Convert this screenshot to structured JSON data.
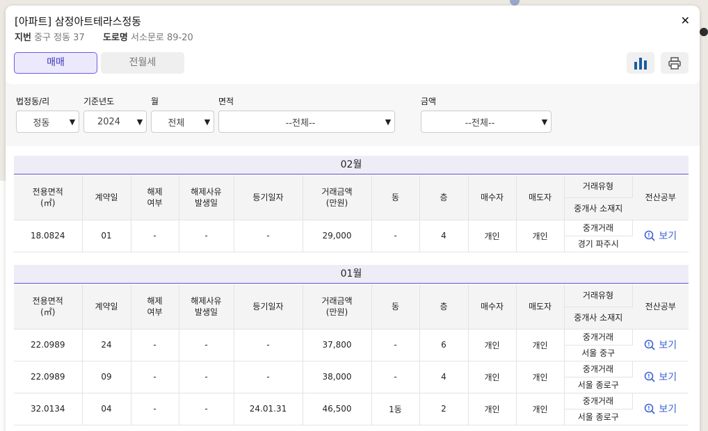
{
  "header": {
    "title": "[아파트] 삼정아트테라스정동",
    "jibun_label": "지번",
    "jibun_value": "중구 정동 37",
    "road_label": "도로명",
    "road_value": "서소문로 89-20",
    "close_icon": "close-icon"
  },
  "tabs": [
    {
      "label": "매매",
      "active": true
    },
    {
      "label": "전월세",
      "active": false
    }
  ],
  "actions": {
    "chart_icon": "bar-chart-icon",
    "print_icon": "printer-icon"
  },
  "filters": {
    "dong": {
      "label": "법정동/리",
      "value": "정동"
    },
    "year": {
      "label": "기준년도",
      "value": "2024"
    },
    "month": {
      "label": "월",
      "value": "전체"
    },
    "area": {
      "label": "면적",
      "value": "--전체--"
    },
    "price": {
      "label": "금액",
      "value": "--전체--"
    }
  },
  "columns": {
    "area": "전용면적\n(㎡)",
    "contract_day": "계약일",
    "cancel": "해제\n여부",
    "cancel_date": "해제사유\n발생일",
    "reg_date": "등기일자",
    "price": "거래금액\n(만원)",
    "building": "동",
    "floor": "층",
    "buyer": "매수자",
    "seller": "매도자",
    "deal_type": "거래유형",
    "agent_loc": "중개사 소재지",
    "ledger": "전산공부"
  },
  "months": [
    {
      "label": "02월",
      "rows": [
        {
          "area": "18.0824",
          "day": "01",
          "cancel": "-",
          "cancel_date": "-",
          "reg_date": "-",
          "price": "29,000",
          "building": "-",
          "floor": "4",
          "buyer": "개인",
          "seller": "개인",
          "deal_type": "중개거래",
          "agent_loc": "경기 파주시",
          "view": "보기"
        }
      ]
    },
    {
      "label": "01월",
      "rows": [
        {
          "area": "22.0989",
          "day": "24",
          "cancel": "-",
          "cancel_date": "-",
          "reg_date": "-",
          "price": "37,800",
          "building": "-",
          "floor": "6",
          "buyer": "개인",
          "seller": "개인",
          "deal_type": "중개거래",
          "agent_loc": "서울 중구",
          "view": "보기"
        },
        {
          "area": "22.0989",
          "day": "09",
          "cancel": "-",
          "cancel_date": "-",
          "reg_date": "-",
          "price": "38,000",
          "building": "-",
          "floor": "4",
          "buyer": "개인",
          "seller": "개인",
          "deal_type": "중개거래",
          "agent_loc": "서울 종로구",
          "view": "보기"
        },
        {
          "area": "32.0134",
          "day": "04",
          "cancel": "-",
          "cancel_date": "-",
          "reg_date": "24.01.31",
          "price": "46,500",
          "building": "1동",
          "floor": "2",
          "buyer": "개인",
          "seller": "개인",
          "deal_type": "중개거래",
          "agent_loc": "서울 종로구",
          "view": "보기"
        }
      ]
    }
  ],
  "colors": {
    "accent": "#5b52c8",
    "link": "#3d63d8",
    "tab_active_bg": "#ebe9fb",
    "chart_icon": "#1a5e9e"
  }
}
